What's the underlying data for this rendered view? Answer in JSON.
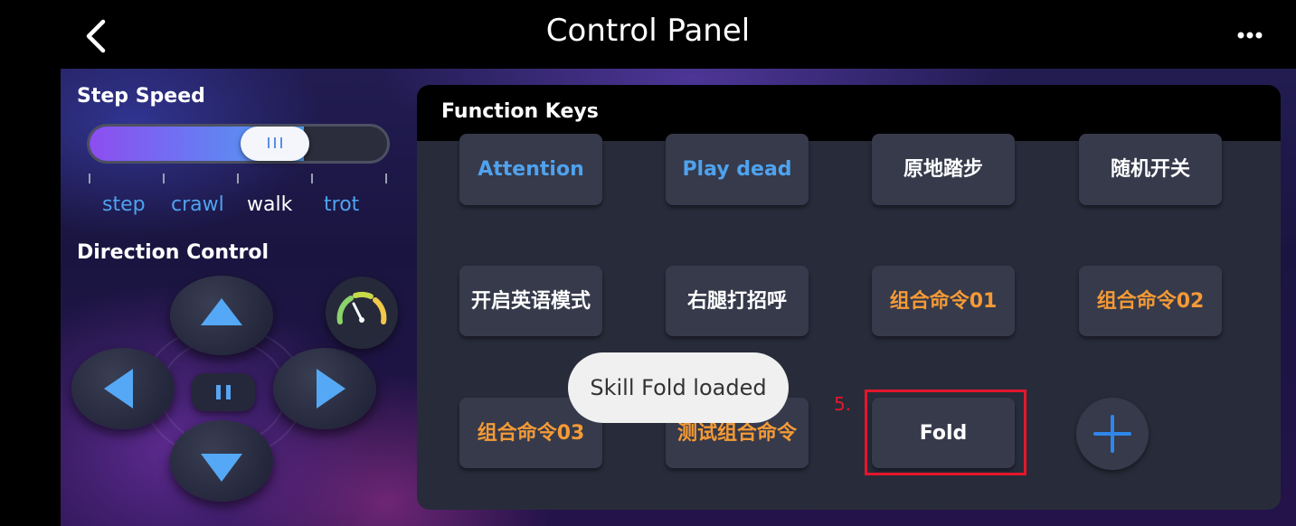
{
  "header": {
    "title": "Control Panel",
    "back_icon": "chevron-left-icon",
    "more_icon": "more-horizontal-icon"
  },
  "step_speed": {
    "label": "Step Speed",
    "value": 0.72,
    "gears": [
      {
        "label": "step",
        "active": false
      },
      {
        "label": "crawl",
        "active": false
      },
      {
        "label": "walk",
        "active": true
      },
      {
        "label": "trot",
        "active": false
      }
    ]
  },
  "direction": {
    "label": "Direction Control",
    "icons": [
      "arrow-up-icon",
      "arrow-left-icon",
      "pause-icon",
      "arrow-right-icon",
      "arrow-down-icon",
      "speedometer-icon"
    ]
  },
  "function_keys": {
    "title": "Function Keys",
    "keys": [
      {
        "label": "Attention",
        "color": "#4fa2ee"
      },
      {
        "label": "Play dead",
        "color": "#4fa2ee"
      },
      {
        "label": "原地踏步",
        "color": "#ffffff"
      },
      {
        "label": "随机开关",
        "color": "#ffffff"
      },
      {
        "label": "开启英语模式",
        "color": "#ffffff"
      },
      {
        "label": "右腿打招呼",
        "color": "#ffffff"
      },
      {
        "label": "组合命令01",
        "color": "#f59a35"
      },
      {
        "label": "组合命令02",
        "color": "#f59a35"
      },
      {
        "label": "组合命令03",
        "color": "#f59a35"
      },
      {
        "label": "测试组合命令",
        "color": "#f59a35"
      },
      {
        "label": "Fold",
        "color": "#ffffff"
      }
    ],
    "add_icon": "plus-icon"
  },
  "annotation": {
    "step": "5."
  },
  "toast": {
    "message": "Skill Fold loaded"
  }
}
